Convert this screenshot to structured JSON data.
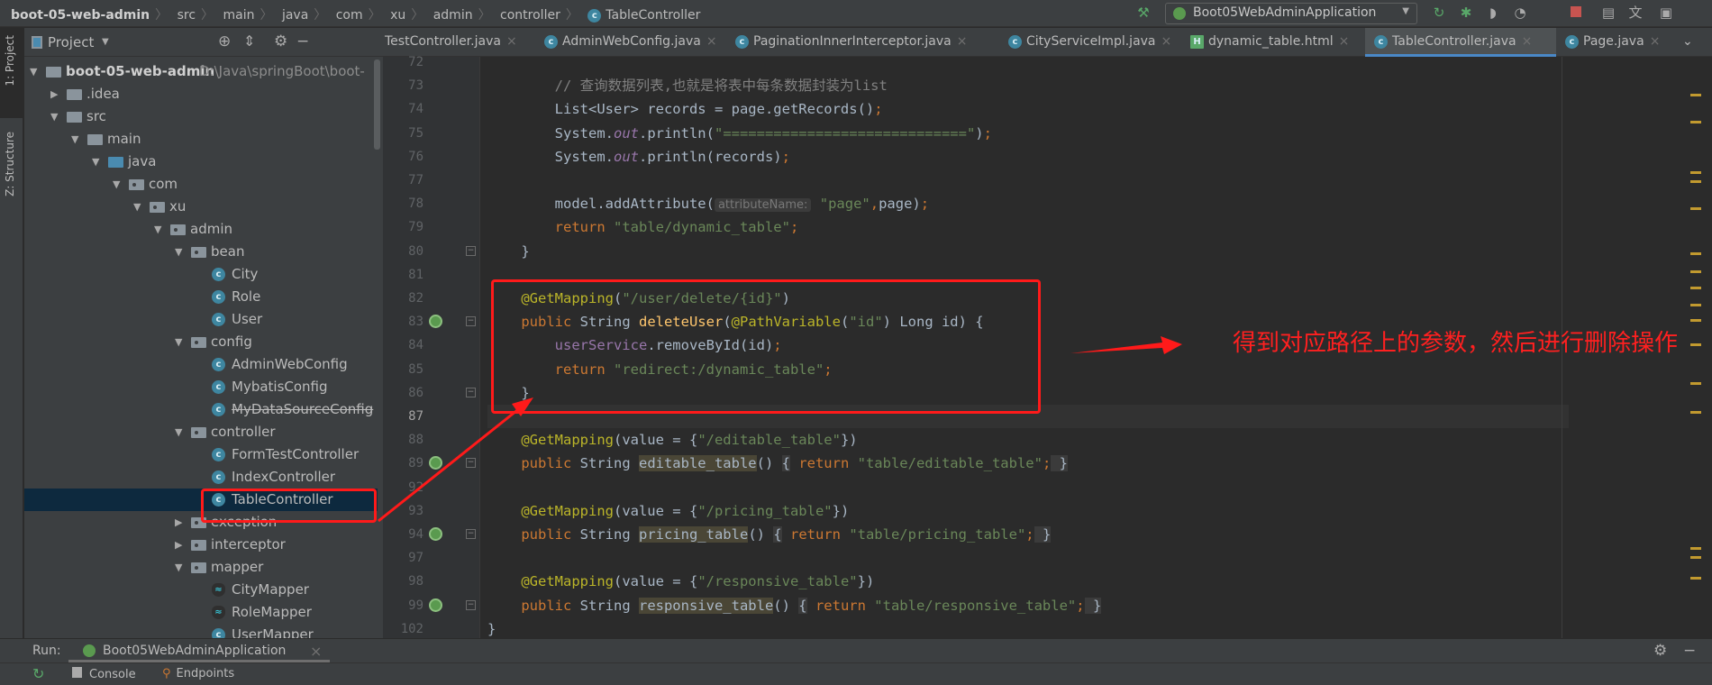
{
  "breadcrumb": {
    "project": "boot-05-web-admin",
    "items": [
      "src",
      "main",
      "java",
      "com",
      "xu",
      "admin",
      "controller"
    ],
    "current": "TableController"
  },
  "toolbar": {
    "run_config": "Boot05WebAdminApplication",
    "icons": [
      "build-hammer-icon",
      "rerun-icon",
      "debug-icon",
      "coverage-icon",
      "profile-icon",
      "stop-icon",
      "project-structure-icon",
      "translate-icon",
      "terminal-icon"
    ]
  },
  "side_tabs": {
    "project": "1: Project",
    "structure": "Z: Structure"
  },
  "project_panel": {
    "title": "Project",
    "root_path": "D:\\Java\\springBoot\\boot-"
  },
  "tree": [
    {
      "label": "boot-05-web-admin",
      "level": 0,
      "type": "module",
      "open": true
    },
    {
      "label": ".idea",
      "level": 1,
      "type": "folder",
      "open": false
    },
    {
      "label": "src",
      "level": 1,
      "type": "folder",
      "open": true
    },
    {
      "label": "main",
      "level": 2,
      "type": "folder",
      "open": true
    },
    {
      "label": "java",
      "level": 3,
      "type": "src",
      "open": true
    },
    {
      "label": "com",
      "level": 4,
      "type": "pkg",
      "open": true
    },
    {
      "label": "xu",
      "level": 5,
      "type": "pkg",
      "open": true
    },
    {
      "label": "admin",
      "level": 6,
      "type": "pkg",
      "open": true
    },
    {
      "label": "bean",
      "level": 7,
      "type": "pkg",
      "open": true
    },
    {
      "label": "City",
      "level": 8,
      "type": "class"
    },
    {
      "label": "Role",
      "level": 8,
      "type": "class"
    },
    {
      "label": "User",
      "level": 8,
      "type": "class"
    },
    {
      "label": "config",
      "level": 7,
      "type": "pkg",
      "open": true
    },
    {
      "label": "AdminWebConfig",
      "level": 8,
      "type": "class"
    },
    {
      "label": "MybatisConfig",
      "level": 8,
      "type": "class"
    },
    {
      "label": "MyDataSourceConfig",
      "level": 8,
      "type": "class",
      "strike": true
    },
    {
      "label": "controller",
      "level": 7,
      "type": "pkg",
      "open": true
    },
    {
      "label": "FormTestController",
      "level": 8,
      "type": "class"
    },
    {
      "label": "IndexController",
      "level": 8,
      "type": "class"
    },
    {
      "label": "TableController",
      "level": 8,
      "type": "class",
      "selected": true
    },
    {
      "label": "exception",
      "level": 7,
      "type": "pkg",
      "open": false
    },
    {
      "label": "interceptor",
      "level": 7,
      "type": "pkg",
      "open": false
    },
    {
      "label": "mapper",
      "level": 7,
      "type": "pkg",
      "open": true
    },
    {
      "label": "CityMapper",
      "level": 8,
      "type": "mapper"
    },
    {
      "label": "RoleMapper",
      "level": 8,
      "type": "mapper"
    },
    {
      "label": "UserMapper",
      "level": 8,
      "type": "class"
    }
  ],
  "tabs": [
    {
      "label": "TestController.java",
      "icon": "none"
    },
    {
      "label": "AdminWebConfig.java",
      "icon": "class"
    },
    {
      "label": "PaginationInnerInterceptor.java",
      "icon": "class"
    },
    {
      "label": "CityServiceImpl.java",
      "icon": "class"
    },
    {
      "label": "dynamic_table.html",
      "icon": "html"
    },
    {
      "label": "TableController.java",
      "icon": "class",
      "active": true
    },
    {
      "label": "Page.java",
      "icon": "class"
    }
  ],
  "code": [
    {
      "n": "72",
      "t": []
    },
    {
      "n": "73",
      "t": [
        [
          "cmt",
          "        // 查询数据列表,也就是将表中每条数据封装为list"
        ]
      ]
    },
    {
      "n": "74",
      "t": [
        [
          "",
          "        List<User> records = page.getRecords()"
        ],
        [
          "kw",
          ";"
        ]
      ]
    },
    {
      "n": "75",
      "t": [
        [
          "",
          "        System."
        ],
        [
          "fld",
          "out"
        ],
        [
          "",
          ".println("
        ],
        [
          "str",
          "\"=============================\""
        ],
        [
          "",
          ")"
        ],
        [
          "kw",
          ";"
        ]
      ]
    },
    {
      "n": "76",
      "t": [
        [
          "",
          "        System."
        ],
        [
          "fld",
          "out"
        ],
        [
          "",
          ".println(records)"
        ],
        [
          "kw",
          ";"
        ]
      ]
    },
    {
      "n": "77",
      "t": []
    },
    {
      "n": "78",
      "t": [
        [
          "",
          "        model.addAttribute("
        ],
        [
          "hint",
          "attributeName:"
        ],
        [
          "str",
          " \"page\""
        ],
        [
          "kw",
          ","
        ],
        [
          "",
          "page)"
        ],
        [
          "kw",
          ";"
        ]
      ]
    },
    {
      "n": "79",
      "t": [
        [
          "kw",
          "        return "
        ],
        [
          "str",
          "\"table/dynamic_table\""
        ],
        [
          "kw",
          ";"
        ]
      ]
    },
    {
      "n": "80",
      "t": [
        [
          "",
          "    }"
        ]
      ],
      "fold": true
    },
    {
      "n": "81",
      "t": []
    },
    {
      "n": "82",
      "t": [
        [
          "ann",
          "    @GetMapping"
        ],
        [
          "",
          "("
        ],
        [
          "str",
          "\"/user/delete/{id}\""
        ],
        [
          "",
          ")"
        ]
      ]
    },
    {
      "n": "83",
      "t": [
        [
          "kw",
          "    public "
        ],
        [
          "",
          "String "
        ],
        [
          "fn",
          "deleteUser"
        ],
        [
          "",
          "("
        ],
        [
          "ann",
          "@PathVariable"
        ],
        [
          "",
          "("
        ],
        [
          "str",
          "\"id\""
        ],
        [
          "",
          ") Long id) {"
        ]
      ],
      "icon": true,
      "fold": true
    },
    {
      "n": "84",
      "t": [
        [
          "var",
          "        userService"
        ],
        [
          "",
          ".removeById(id)"
        ],
        [
          "kw",
          ";"
        ]
      ]
    },
    {
      "n": "85",
      "t": [
        [
          "kw",
          "        return "
        ],
        [
          "str",
          "\"redirect:/dynamic_table\""
        ],
        [
          "kw",
          ";"
        ]
      ]
    },
    {
      "n": "86",
      "t": [
        [
          "",
          "    }"
        ]
      ],
      "fold": true
    },
    {
      "n": "87",
      "t": [],
      "current": true
    },
    {
      "n": "88",
      "t": [
        [
          "ann",
          "    @GetMapping"
        ],
        [
          "",
          "(value = {"
        ],
        [
          "str",
          "\"/editable_table\""
        ],
        [
          "",
          "})"
        ]
      ]
    },
    {
      "n": "89",
      "t": [
        [
          "kw",
          "    public "
        ],
        [
          "",
          "String "
        ],
        [
          "hl",
          "editable_table"
        ],
        [
          "",
          "() "
        ],
        [
          "brk",
          "{"
        ],
        [
          "kw",
          " return "
        ],
        [
          "str",
          "\"table/editable_table\""
        ],
        [
          "kw",
          ";"
        ],
        [
          "brk",
          " }"
        ]
      ],
      "icon": true,
      "fold": true
    },
    {
      "n": "92",
      "t": []
    },
    {
      "n": "93",
      "t": [
        [
          "ann",
          "    @GetMapping"
        ],
        [
          "",
          "(value = {"
        ],
        [
          "str",
          "\"/pricing_table\""
        ],
        [
          "",
          "})"
        ]
      ]
    },
    {
      "n": "94",
      "t": [
        [
          "kw",
          "    public "
        ],
        [
          "",
          "String "
        ],
        [
          "hl",
          "pricing_table"
        ],
        [
          "",
          "() "
        ],
        [
          "brk",
          "{"
        ],
        [
          "kw",
          " return "
        ],
        [
          "str",
          "\"table/pricing_table\""
        ],
        [
          "kw",
          ";"
        ],
        [
          "brk",
          " }"
        ]
      ],
      "icon": true,
      "fold": true
    },
    {
      "n": "97",
      "t": []
    },
    {
      "n": "98",
      "t": [
        [
          "ann",
          "    @GetMapping"
        ],
        [
          "",
          "(value = {"
        ],
        [
          "str",
          "\"/responsive_table\""
        ],
        [
          "",
          "})"
        ]
      ]
    },
    {
      "n": "99",
      "t": [
        [
          "kw",
          "    public "
        ],
        [
          "",
          "String "
        ],
        [
          "hl",
          "responsive_table"
        ],
        [
          "",
          "() "
        ],
        [
          "brk",
          "{"
        ],
        [
          "kw",
          " return "
        ],
        [
          "str",
          "\"table/responsive_table\""
        ],
        [
          "kw",
          ";"
        ],
        [
          "brk",
          " }"
        ]
      ],
      "icon": true,
      "fold": true
    },
    {
      "n": "102",
      "t": [
        [
          "",
          "}"
        ]
      ]
    }
  ],
  "annotation": {
    "text": "得到对应路径上的参数，然后进行删除操作",
    "color": "#ff2020"
  },
  "run_panel": {
    "label": "Run:",
    "tab": "Boot05WebAdminApplication",
    "tools": [
      "Console",
      "Endpoints"
    ]
  },
  "colors": {
    "accent": "#4a88c7",
    "keyword": "#cc7832",
    "string": "#6a8759",
    "annotation": "#bbb529",
    "method": "#ffc66d",
    "highlight_box": "#ff1a1a"
  }
}
